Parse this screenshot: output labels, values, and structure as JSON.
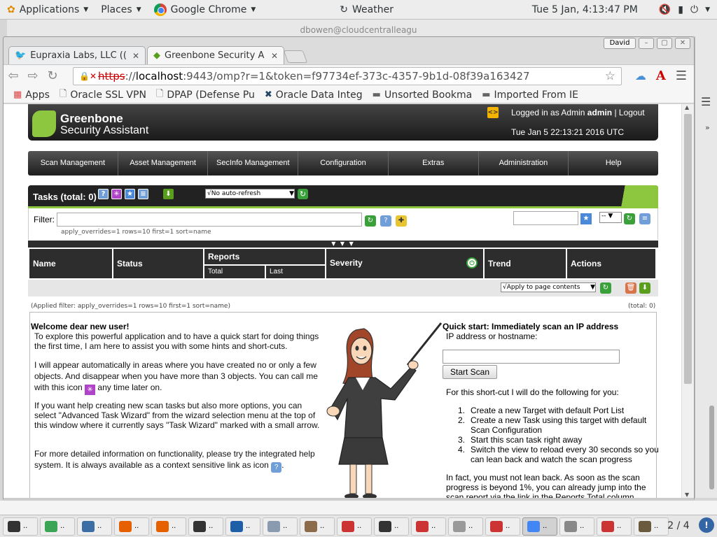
{
  "gnome_panel": {
    "applications": "Applications",
    "places": "Places",
    "active_app": "Google Chrome",
    "weather": "Weather",
    "clock": "Tue  5 Jan,  4:13:47 PM"
  },
  "background_window": {
    "title": "dbowen@cloudcentralleagu"
  },
  "browser": {
    "tabs": [
      {
        "label": "Eupraxia Labs, LLC (("
      },
      {
        "label": "Greenbone Security A"
      }
    ],
    "user_button": "David",
    "url": {
      "scheme": "https",
      "separator": "://",
      "host": "localhost",
      "rest": ":9443/omp?r=1&token=f97734ef-373c-4357-9b1d-08f39a163427"
    },
    "bookmarks": [
      {
        "label": "Apps",
        "icon": "apps-grid-icon"
      },
      {
        "label": "Oracle SSL VPN",
        "icon": "page-icon"
      },
      {
        "label": "DPAP (Defense Pu",
        "icon": "page-icon"
      },
      {
        "label": "Oracle Data Integ",
        "icon": "odi-icon"
      },
      {
        "label": "Unsorted Bookma",
        "icon": "folder-icon"
      },
      {
        "label": "Imported From IE",
        "icon": "folder-icon"
      }
    ]
  },
  "gsa": {
    "brand_line1": "Greenbone",
    "brand_line2": "Security Assistant",
    "logged_in_prefix": "Logged in as Admin",
    "username": "admin",
    "logout": "Logout",
    "datetime": "Tue Jan 5 22:13:21 2016 UTC",
    "menu": [
      "Scan Management",
      "Asset Management",
      "SecInfo Management",
      "Configuration",
      "Extras",
      "Administration",
      "Help"
    ],
    "section_title": "Tasks (total: 0)",
    "refresh_option": "√No auto-refresh",
    "filter_label": "Filter:",
    "filter_value": "",
    "filter_hint": "apply_overrides=1 rows=10 first=1 sort=name",
    "filter_select": "--",
    "separator_arrows": "▼ ▼ ▼",
    "columns": {
      "name": "Name",
      "status": "Status",
      "reports": "Reports",
      "reports_total": "Total",
      "reports_last": "Last",
      "severity": "Severity",
      "trend": "Trend",
      "actions": "Actions"
    },
    "apply_option": "√Apply to page contents",
    "applied_filter": "(Applied filter: apply_overrides=1 rows=10 first=1 sort=name)",
    "total": "(total: 0)"
  },
  "welcome": {
    "title": "Welcome dear new user!",
    "p1": "To explore this powerful application and to have a quick start for doing things the first time, I am here to assist you with some hints and short-cuts.",
    "p2a": "I will appear automatically in areas where you have created no or only a few objects. And disappear when you have more than 3 objects. You can call me with this icon",
    "p2b": "any time later on.",
    "p3": "If you want help creating new scan tasks but also more options, you can select \"Advanced Task Wizard\" from the wizard selection menu at the top of this window where it currently says \"Task Wizard\" marked with a small arrow.",
    "p4a": "For more detailed information on functionality, please try the integrated help system. It is always available as a context sensitive link as icon",
    "p4b": "."
  },
  "quickstart": {
    "title": "Quick start: Immediately scan an IP address",
    "label": "IP address or hostname:",
    "input_value": "",
    "button": "Start Scan",
    "intro": "For this short-cut I will do the following for you:",
    "steps": [
      "Create a new Target with default Port List",
      "Create a new Task using this target with default Scan Configuration",
      "Start this scan task right away",
      "Switch the view to reload every 30 seconds so you can lean back and watch the scan progress"
    ],
    "fact": "In fact, you must not lean back. As soon as the scan progress is beyond 1%, you can already jump into the scan report via the link in the Reports Total column"
  },
  "taskbar": {
    "pager": "2 / 4",
    "items": [
      {
        "icon": "terminal-icon",
        "color": "#333333"
      },
      {
        "icon": "atom-icon",
        "color": "#3aa655"
      },
      {
        "icon": "thunderbird-icon",
        "color": "#3b6ea5"
      },
      {
        "icon": "firefox-icon",
        "color": "#e66000"
      },
      {
        "icon": "firefox-icon",
        "color": "#e66000"
      },
      {
        "icon": "terminal-icon",
        "color": "#333333"
      },
      {
        "icon": "virtualbox-icon",
        "color": "#1f5fa8"
      },
      {
        "icon": "virtualbox-icon",
        "color": "#8a9bb0"
      },
      {
        "icon": "gear-icon",
        "color": "#8b6b4a"
      },
      {
        "icon": "app-icon",
        "color": "#c33"
      },
      {
        "icon": "terminal-icon",
        "color": "#333333"
      },
      {
        "icon": "app-icon",
        "color": "#c33"
      },
      {
        "icon": "editor-icon",
        "color": "#999999"
      },
      {
        "icon": "app-icon",
        "color": "#c33"
      },
      {
        "icon": "chrome-icon",
        "color": "#4285f4"
      },
      {
        "icon": "files-icon",
        "color": "#888888"
      },
      {
        "icon": "app-icon",
        "color": "#c33"
      },
      {
        "icon": "gimp-icon",
        "color": "#6b5b3e"
      }
    ]
  }
}
